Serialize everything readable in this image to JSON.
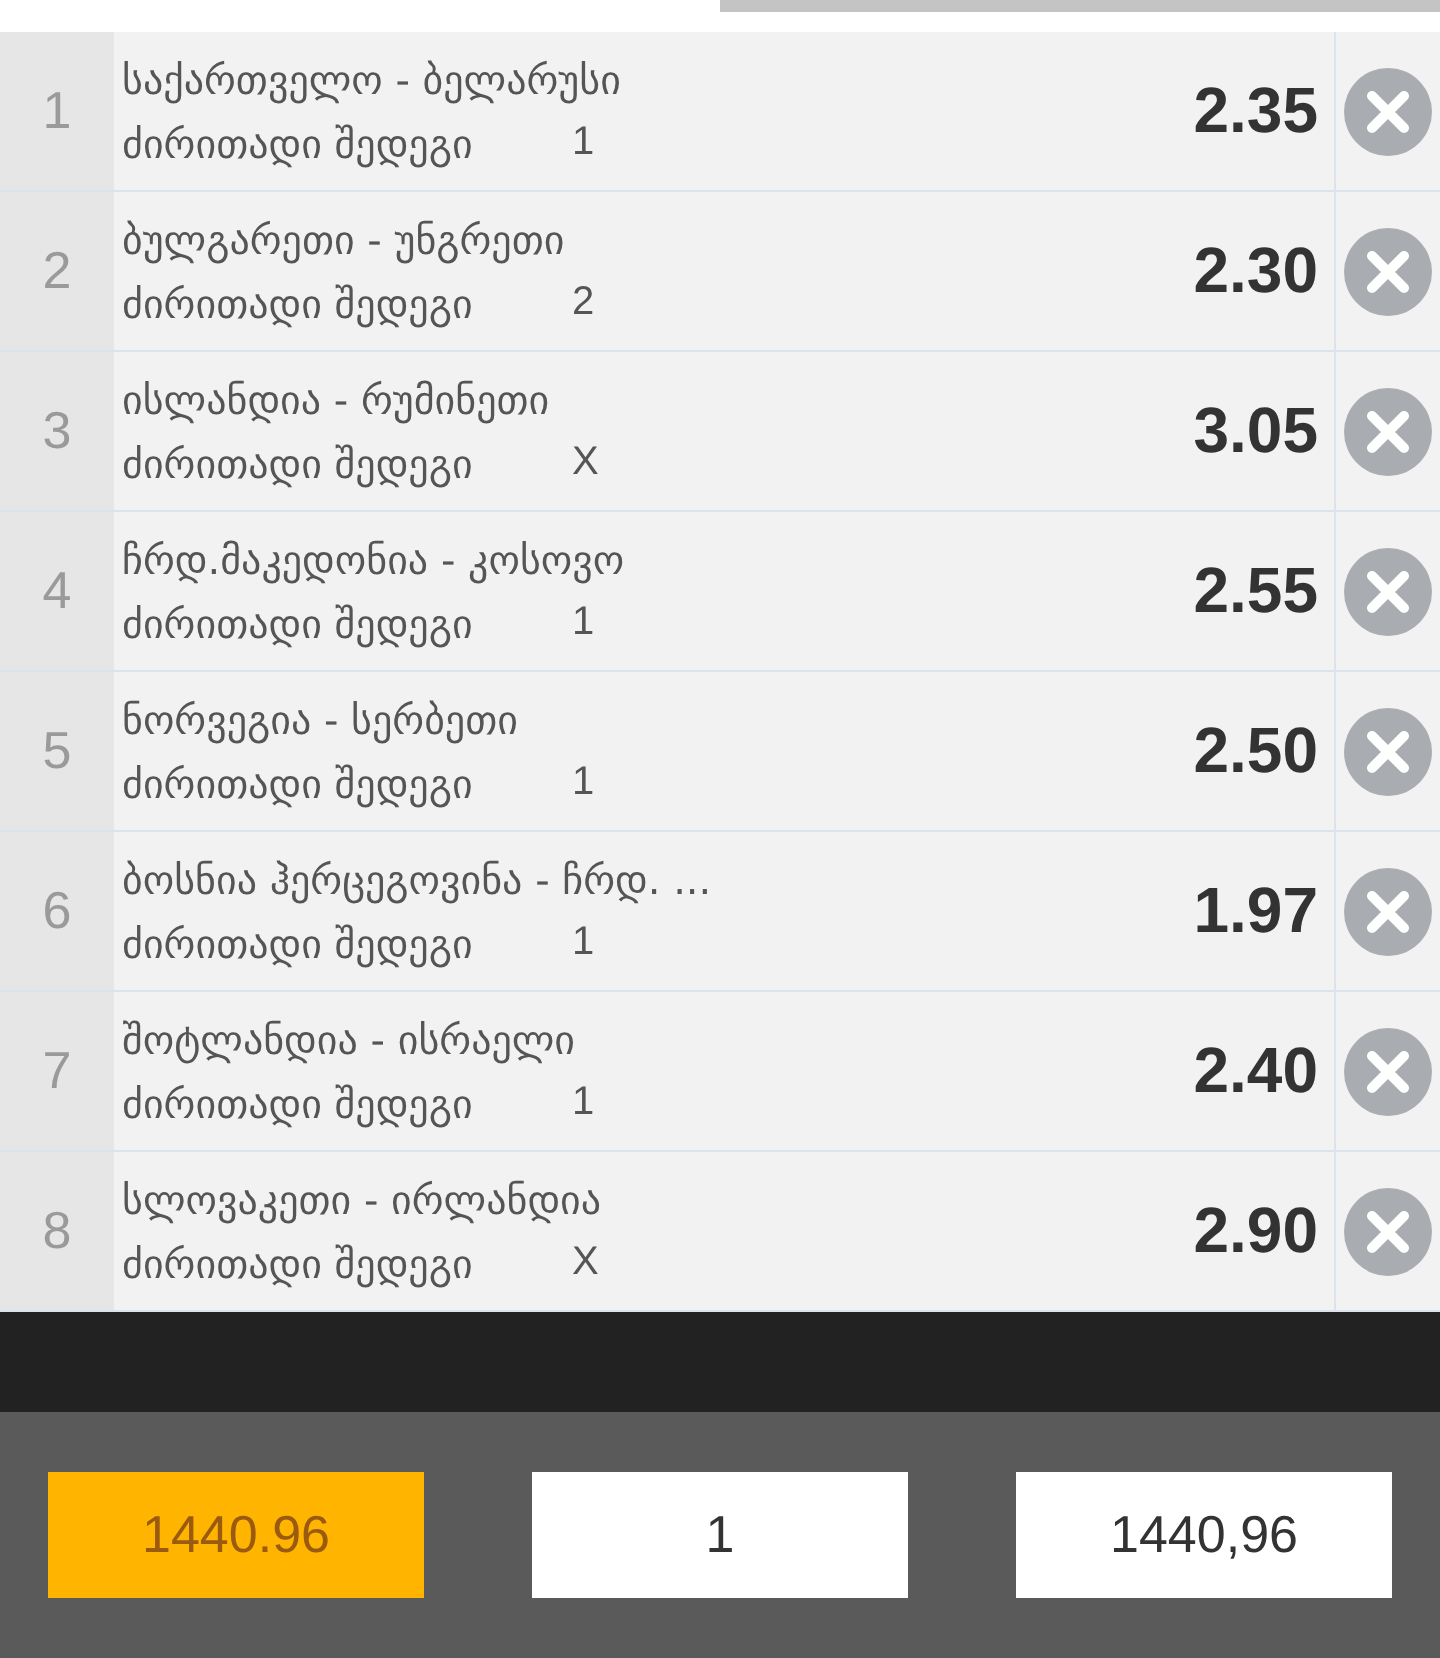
{
  "bets": [
    {
      "number": "1",
      "match": "საქართველო - ბელარუსი",
      "market": "ძირითადი შედეგი",
      "pick": "1",
      "odds": "2.35"
    },
    {
      "number": "2",
      "match": "ბულგარეთი - უნგრეთი",
      "market": "ძირითადი შედეგი",
      "pick": "2",
      "odds": "2.30"
    },
    {
      "number": "3",
      "match": "ისლანდია - რუმინეთი",
      "market": "ძირითადი შედეგი",
      "pick": "X",
      "odds": "3.05"
    },
    {
      "number": "4",
      "match": "ჩრდ.მაკედონია - კოსოვო",
      "market": "ძირითადი შედეგი",
      "pick": "1",
      "odds": "2.55"
    },
    {
      "number": "5",
      "match": "ნორვეგია - სერბეთი",
      "market": "ძირითადი შედეგი",
      "pick": "1",
      "odds": "2.50"
    },
    {
      "number": "6",
      "match": "ბოსნია ჰერცეგოვინა - ჩრდ. ...",
      "market": "ძირითადი შედეგი",
      "pick": "1",
      "odds": "1.97"
    },
    {
      "number": "7",
      "match": "შოტლანდია - ისრაელი",
      "market": "ძირითადი შედეგი",
      "pick": "1",
      "odds": "2.40"
    },
    {
      "number": "8",
      "match": "სლოვაკეთი - ირლანდია",
      "market": "ძირითადი შედეგი",
      "pick": "X",
      "odds": "2.90"
    }
  ],
  "footer": [
    {
      "kind": "highlight",
      "value": "1440.96"
    },
    {
      "kind": "field",
      "value": "1"
    },
    {
      "kind": "field",
      "value": "1440,96"
    }
  ]
}
